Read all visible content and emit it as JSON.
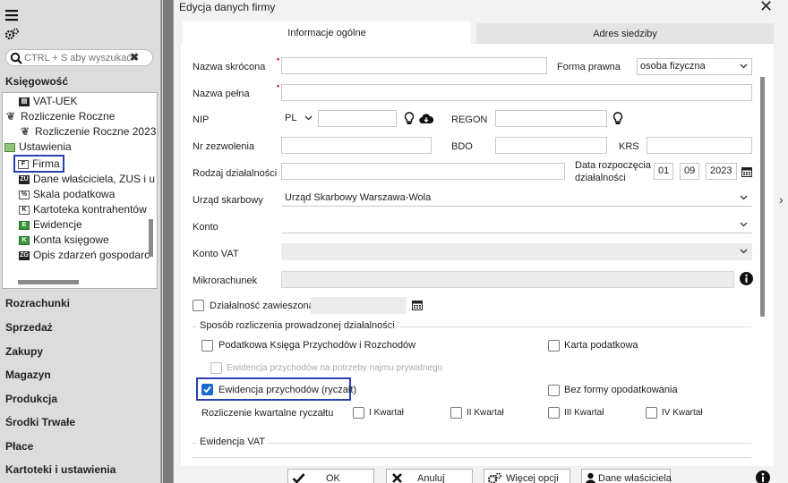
{
  "left_panel": {
    "search_placeholder": "CTRL + S aby wyszukać",
    "section_title": "Księgowość",
    "tree": [
      {
        "label": "VAT-UEK"
      },
      {
        "label": "Rozliczenie Roczne"
      },
      {
        "label": "Rozliczenie Roczne 2023"
      },
      {
        "label": "Ustawienia"
      },
      {
        "label": "Firma"
      },
      {
        "label": "Dane właściciela, ZUS i u"
      },
      {
        "label": "Skala podatkowa"
      },
      {
        "label": "Kartoteka kontrahentów"
      },
      {
        "label": "Ewidencje"
      },
      {
        "label": "Konta księgowe"
      },
      {
        "label": "Opis zdarzeń gospodarc"
      }
    ],
    "nav": [
      "Rozrachunki",
      "Sprzedaż",
      "Zakupy",
      "Magazyn",
      "Produkcja",
      "Środki Trwałe",
      "Płace",
      "Kartoteki i ustawienia"
    ]
  },
  "dialog": {
    "title": "Edycja danych firmy",
    "tabs": [
      "Informacje ogólne",
      "Adres siedziby"
    ],
    "form": {
      "nazwa_skrocona_label": "Nazwa skrócona",
      "nazwa_skrocona_value": "",
      "forma_prawna_label": "Forma prawna",
      "forma_prawna_value": "osoba fizyczna",
      "nazwa_pelna_label": "Nazwa pełna",
      "nazwa_pelna_value": "",
      "nip_label": "NIP",
      "nip_country": "PL",
      "nip_value": "",
      "regon_label": "REGON",
      "nr_zezwolenia_label": "Nr zezwolenia",
      "bdo_label": "BDO",
      "krs_label": "KRS",
      "rodzaj_label": "Rodzaj działalności",
      "data_label_1": "Data rozpoczęcia",
      "data_label_2": "działalności",
      "data_day": "01",
      "data_month": "09",
      "data_year": "2023",
      "urzad_label": "Urząd skarbowy",
      "urzad_value": "Urząd Skarbowy Warszawa-Wola",
      "konto_label": "Konto",
      "konto_vat_label": "Konto VAT",
      "mikrorachunek_label": "Mikrorachunek",
      "zawieszona_label": "Działalność zawieszona",
      "sposob_title": "Sposób rozliczenia prowadzonej działalności",
      "pkpir_label": "Podatkowa Księga Przychodów i Rozchodów",
      "karta_label": "Karta podatkowa",
      "najem_label": "Ewidencja przychodów na potrzeby najmu prywatnego",
      "ryczalt_label": "Ewidencja przychodów (ryczałt)",
      "bez_formy_label": "Bez formy opodatkowania",
      "kwartalne_label": "Rozliczenie kwartalne ryczałtu",
      "quarters": [
        "I Kwartał",
        "II Kwartał",
        "III Kwartał",
        "IV Kwartał"
      ],
      "vat_title": "Ewidencja VAT"
    },
    "buttons": {
      "ok": "OK",
      "anuluj": "Anuluj",
      "wiecej": "Więcej opcji",
      "wlasciciela": "Dane właściciela"
    }
  },
  "colors": {
    "highlight": "#2b3fb0",
    "checkbox_checked": "#1a6bd1",
    "required_marker": "#e01010"
  }
}
